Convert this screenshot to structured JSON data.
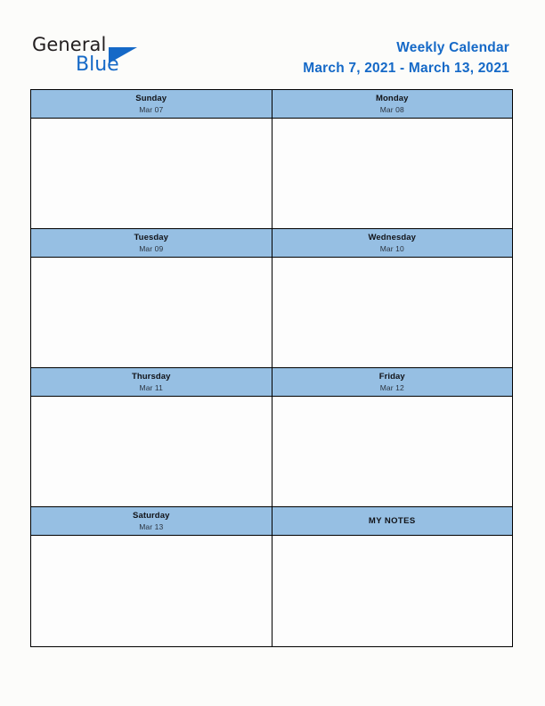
{
  "logo": {
    "word_general": "General",
    "word_blue": "Blue",
    "triangle_icon": "triangle-icon",
    "brand_color": "#1569c7",
    "general_color": "#231f20"
  },
  "header": {
    "title": "Weekly Calendar",
    "date_range": "March 7, 2021 - March 13, 2021",
    "title_color": "#1569c7"
  },
  "theme": {
    "header_cell_background": "#96bfe3",
    "cell_background": "#fdfdfd",
    "page_background": "#fcfcfa",
    "border_color": "#000000",
    "day_name_color": "#111318",
    "day_date_color": "#2b3440"
  },
  "calendar": {
    "rows": [
      {
        "left": {
          "kind": "day",
          "name": "Sunday",
          "date": "Mar 07",
          "content": ""
        },
        "right": {
          "kind": "day",
          "name": "Monday",
          "date": "Mar 08",
          "content": ""
        }
      },
      {
        "left": {
          "kind": "day",
          "name": "Tuesday",
          "date": "Mar 09",
          "content": ""
        },
        "right": {
          "kind": "day",
          "name": "Wednesday",
          "date": "Mar 10",
          "content": ""
        }
      },
      {
        "left": {
          "kind": "day",
          "name": "Thursday",
          "date": "Mar 11",
          "content": ""
        },
        "right": {
          "kind": "day",
          "name": "Friday",
          "date": "Mar 12",
          "content": ""
        }
      },
      {
        "left": {
          "kind": "day",
          "name": "Saturday",
          "date": "Mar 13",
          "content": ""
        },
        "right": {
          "kind": "notes",
          "name": "MY NOTES",
          "date": "",
          "content": ""
        }
      }
    ]
  }
}
